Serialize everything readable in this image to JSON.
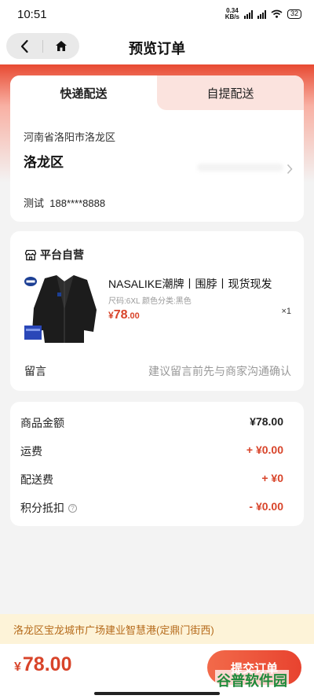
{
  "status_bar": {
    "time": "10:51",
    "net_speed_top": "0.34",
    "net_speed_bottom": "KB/s",
    "battery": "32"
  },
  "nav": {
    "title": "预览订单"
  },
  "delivery": {
    "tabs": [
      {
        "label": "快递配送",
        "active": true
      },
      {
        "label": "自提配送",
        "active": false
      }
    ],
    "region": "河南省洛阳市洛龙区",
    "detail": "洛龙区",
    "contact_name": "测试",
    "contact_phone": "188****8888"
  },
  "product_card": {
    "shop_label": "平台自营",
    "product_name": "NASALIKE潮牌丨围脖丨现货现发",
    "spec": "尺码:6XL  颜色分类:黑色",
    "price_currency": "¥",
    "price_int": "78",
    "price_dec": ".00",
    "quantity": "×1",
    "message_label": "留言",
    "message_placeholder": "建议留言前先与商家沟通确认"
  },
  "summary": {
    "rows": [
      {
        "label": "商品金额",
        "value": "¥78.00"
      },
      {
        "label": "运费",
        "value": "+ ¥0.00"
      },
      {
        "label": "配送费",
        "value": "+ ¥0"
      },
      {
        "label": "积分抵扣",
        "value": "- ¥0.00"
      }
    ],
    "help_glyph": "?"
  },
  "notice": "洛龙区宝龙城市广场建业智慧港(定鼎门街西)",
  "bottom": {
    "currency": "¥",
    "total": "78.00",
    "submit_label": "提交订单"
  },
  "watermark": "谷普软件园",
  "colors": {
    "accent": "#e8432f",
    "price_red": "#d8442a",
    "notice_bg": "#fdf3d8",
    "notice_text": "#b56a1a",
    "inactive_tab_bg": "#fbe3de"
  },
  "icons": {
    "back": "chevron-left-icon",
    "home": "home-icon",
    "shop": "store-icon",
    "address_arrow": "chevron-right-icon",
    "help": "question-circle-icon"
  }
}
